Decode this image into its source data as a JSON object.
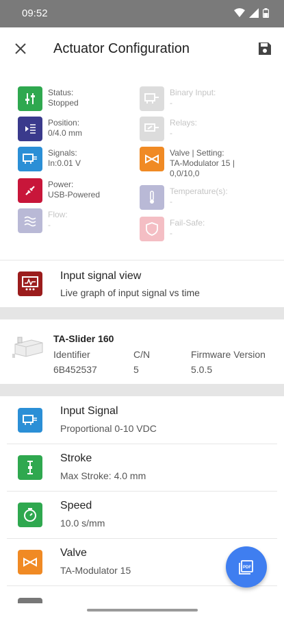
{
  "status_bar": {
    "time": "09:52"
  },
  "app_bar": {
    "title": "Actuator Configuration"
  },
  "status_grid": [
    {
      "label": "Status:",
      "value": "Stopped",
      "icon": "sliders-icon",
      "color": "#2fa84f",
      "enabled": true
    },
    {
      "label": "Binary Input:",
      "value": "-",
      "icon": "binary-input-icon",
      "color": "#9e9e9e",
      "enabled": false
    },
    {
      "label": "Position:",
      "value": "0/4.0 mm",
      "icon": "position-icon",
      "color": "#3a3a8c",
      "enabled": true
    },
    {
      "label": "Relays:",
      "value": "-",
      "icon": "relay-icon",
      "color": "#9e9e9e",
      "enabled": false
    },
    {
      "label": "Signals:",
      "value": "In:0.01 V",
      "icon": "signals-icon",
      "color": "#2b8fd6",
      "enabled": true
    },
    {
      "label": "Valve | Setting:",
      "value": "TA-Modulator 15 | 0,0/10,0",
      "icon": "valve-icon",
      "color": "#f08a24",
      "enabled": true
    },
    {
      "label": "Power:",
      "value": "USB-Powered",
      "icon": "power-icon",
      "color": "#c8163a",
      "enabled": true
    },
    {
      "label": "Temperature(s):",
      "value": "-",
      "icon": "thermometer-icon",
      "color": "#3a3a8c",
      "enabled": false
    },
    {
      "label": "Flow:",
      "value": "-",
      "icon": "flow-icon",
      "color": "#3a3a8c",
      "enabled": false
    },
    {
      "label": "Fail-Safe:",
      "value": "-",
      "icon": "shield-icon",
      "color": "#e0485a",
      "enabled": false
    }
  ],
  "input_signal_view": {
    "title": "Input signal view",
    "subtitle": "Live graph of input signal vs time"
  },
  "device": {
    "name": "TA-Slider 160",
    "identifier_label": "Identifier",
    "identifier": "6B452537",
    "cn_label": "C/N",
    "cn": "5",
    "firmware_label": "Firmware Version",
    "firmware": "5.0.5"
  },
  "config_items": [
    {
      "title": "Input Signal",
      "subtitle": "Proportional 0-10 VDC",
      "icon": "input-signal-icon",
      "color": "#2b8fd6"
    },
    {
      "title": "Stroke",
      "subtitle": "Max Stroke: 4.0 mm",
      "icon": "stroke-icon",
      "color": "#2fa84f"
    },
    {
      "title": "Speed",
      "subtitle": "10.0 s/mm",
      "icon": "stopwatch-icon",
      "color": "#2fa84f"
    },
    {
      "title": "Valve",
      "subtitle": "TA-Modulator 15",
      "icon": "valve-icon",
      "color": "#f08a24"
    }
  ],
  "fab": {
    "icon": "pdf-icon",
    "label": "PDF"
  }
}
